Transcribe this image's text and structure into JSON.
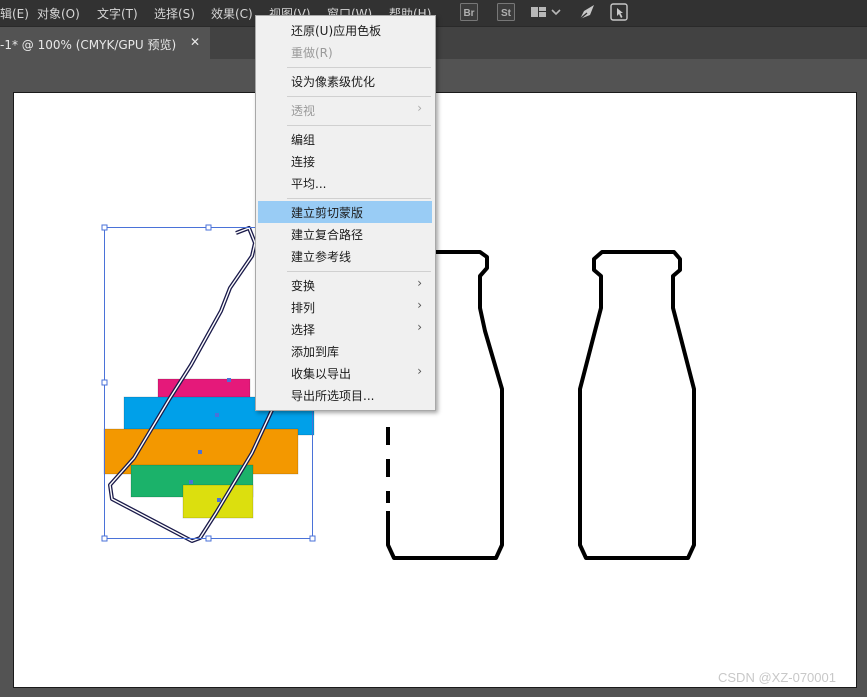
{
  "menubar": {
    "items": [
      "辑(E)",
      "对象(O)",
      "文字(T)",
      "选择(S)",
      "效果(C)",
      "视图(V)",
      "窗口(W)",
      "帮助(H)"
    ],
    "toolbar_icons": [
      "bridge-icon",
      "stock-icon",
      "workspace-layout-icon",
      "dropdown-chevron-icon",
      "gpu-performance-icon",
      "touch-workspace-icon"
    ],
    "br_label": "Br",
    "st_label": "St"
  },
  "document_tab": {
    "title": "-1* @ 100% (CMYK/GPU 预览)",
    "close": "✕"
  },
  "context_menu": {
    "items": [
      {
        "label": "还原(U)应用色板",
        "enabled": true
      },
      {
        "label": "重做(R)",
        "enabled": false
      },
      {
        "label": "设为像素级优化",
        "enabled": true
      },
      {
        "label": "透视",
        "enabled": false,
        "submenu": true
      },
      {
        "label": "编组",
        "enabled": true
      },
      {
        "label": "连接",
        "enabled": true
      },
      {
        "label": "平均...",
        "enabled": true
      },
      {
        "label": "建立剪切蒙版",
        "enabled": true,
        "highlighted": true
      },
      {
        "label": "建立复合路径",
        "enabled": true
      },
      {
        "label": "建立参考线",
        "enabled": true
      },
      {
        "label": "变换",
        "enabled": true,
        "submenu": true
      },
      {
        "label": "排列",
        "enabled": true,
        "submenu": true
      },
      {
        "label": "选择",
        "enabled": true,
        "submenu": true
      },
      {
        "label": "添加到库",
        "enabled": true
      },
      {
        "label": "收集以导出",
        "enabled": true,
        "submenu": true
      },
      {
        "label": "导出所选项目...",
        "enabled": true
      }
    ],
    "submenu_arrow": "›"
  },
  "artwork": {
    "swatch_colors": [
      "#e5197a",
      "#00a0e9",
      "#f39800",
      "#1bb26a",
      "#dcdf0e"
    ],
    "selection_color": "#4a72d8"
  },
  "watermark": "CSDN @XZ-070001"
}
